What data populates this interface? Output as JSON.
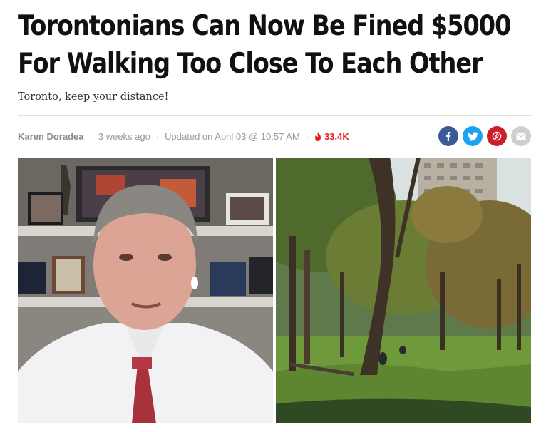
{
  "article": {
    "headline": "Torontonians Can Now Be Fined $5000 For Walking Too Close To Each Other",
    "subtitle": "Toronto, keep your distance!"
  },
  "meta": {
    "author": "Karen Doradea",
    "published": "3 weeks ago",
    "updated": "Updated on April 03 @ 10:57 AM",
    "views": "33.4K",
    "separator": "·"
  },
  "share": {
    "buttons": [
      {
        "icon": "facebook-icon",
        "color": "#3b5998"
      },
      {
        "icon": "twitter-icon",
        "color": "#1da1f2"
      },
      {
        "icon": "pinterest-icon",
        "color": "#cb2027"
      },
      {
        "icon": "email-icon",
        "color": "#cfcfcf"
      }
    ]
  },
  "images": {
    "left": {
      "icon": "man-in-office-photo"
    },
    "right": {
      "icon": "park-with-trees-photo"
    }
  },
  "colors": {
    "views_accent": "#e0201d",
    "divider": "#e1e1e1"
  }
}
